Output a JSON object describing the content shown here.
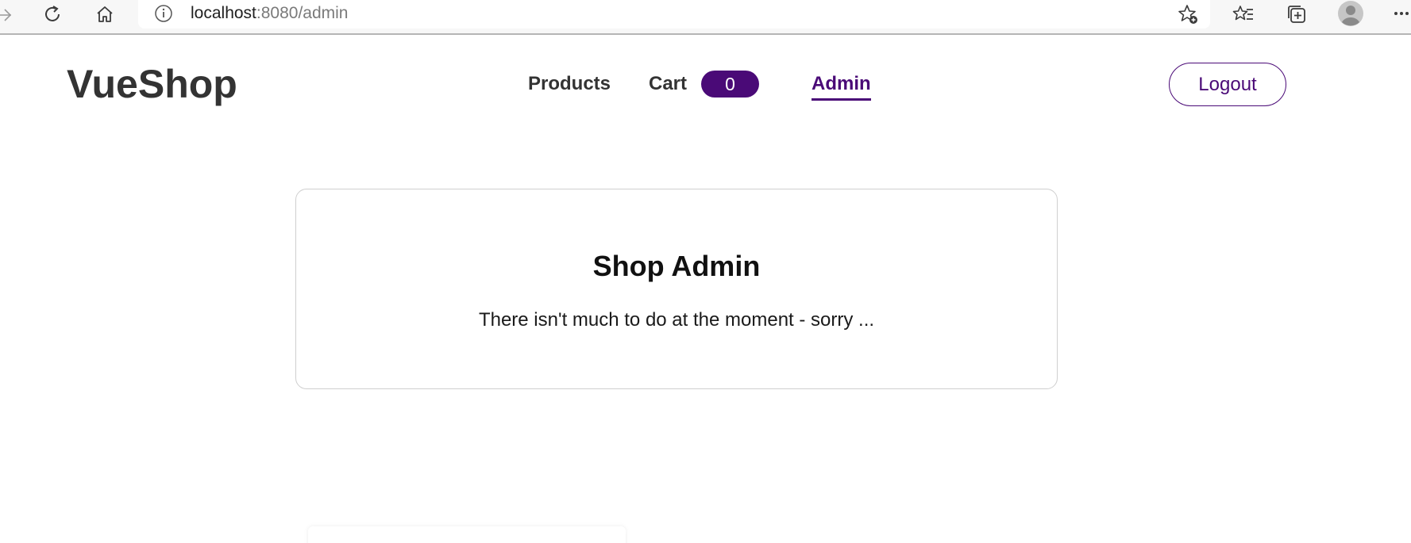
{
  "browser": {
    "address_host": "localhost",
    "address_path": ":8080/admin"
  },
  "app": {
    "logo": "VueShop",
    "nav": {
      "products_label": "Products",
      "cart_label": "Cart",
      "cart_count": "0",
      "admin_label": "Admin"
    },
    "logout_label": "Logout"
  },
  "admin": {
    "title": "Shop Admin",
    "message": "There isn't much to do at the moment - sorry ..."
  },
  "colors": {
    "accent": "#4a0a77",
    "text": "#333333",
    "card_border": "#cfcfcf"
  }
}
